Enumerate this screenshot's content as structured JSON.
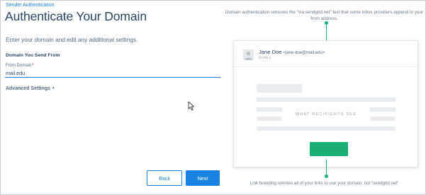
{
  "breadcrumb": "Sender Authentication",
  "title": "Authenticate Your Domain",
  "subtitle": "Enter your domain and edit any additional settings.",
  "form": {
    "section_heading": "Domain You Send From",
    "field_label": "From Domain",
    "required_marker": "*",
    "field_value": "mail.edu",
    "advanced_label": "Advanced Settings",
    "advanced_caret": "▾"
  },
  "buttons": {
    "back": "Back",
    "next": "Next"
  },
  "preview": {
    "top_note": "Domain authentication removes the \"via sendgrid.net\" text that some inbox providers append to your from address.",
    "bottom_note": "Link branding rewrites all of your links to use your domain, not \"sendgrid.net\"",
    "sender_name": "Jane Doe",
    "sender_email": "<jane doe@mail.edu>",
    "to_label": "to me",
    "to_caret": "▾",
    "body_label": "WHAT RECIPIENTS SEE"
  },
  "colors": {
    "accent": "#1a82e2",
    "green": "#1aae72",
    "text": "#294661"
  }
}
